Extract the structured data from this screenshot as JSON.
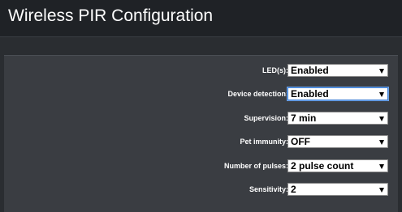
{
  "window": {
    "title": "Wireless PIR Configuration"
  },
  "form": {
    "fields": [
      {
        "label": "LED(s):",
        "value": "Enabled"
      },
      {
        "label": "Device detection:",
        "value": "Enabled"
      },
      {
        "label": "Supervision:",
        "value": "7 min"
      },
      {
        "label": "Pet immunity:",
        "value": "OFF"
      },
      {
        "label": "Number of pulses:",
        "value": "2 pulse count"
      },
      {
        "label": "Sensitivity:",
        "value": "2"
      }
    ]
  },
  "colors": {
    "title_bar": "#1f2226",
    "background": "#2a2d31",
    "panel": "#3a3d42",
    "focus_border": "#3c7fd6"
  },
  "icons": {
    "dropdown": "chevron-down-icon"
  }
}
